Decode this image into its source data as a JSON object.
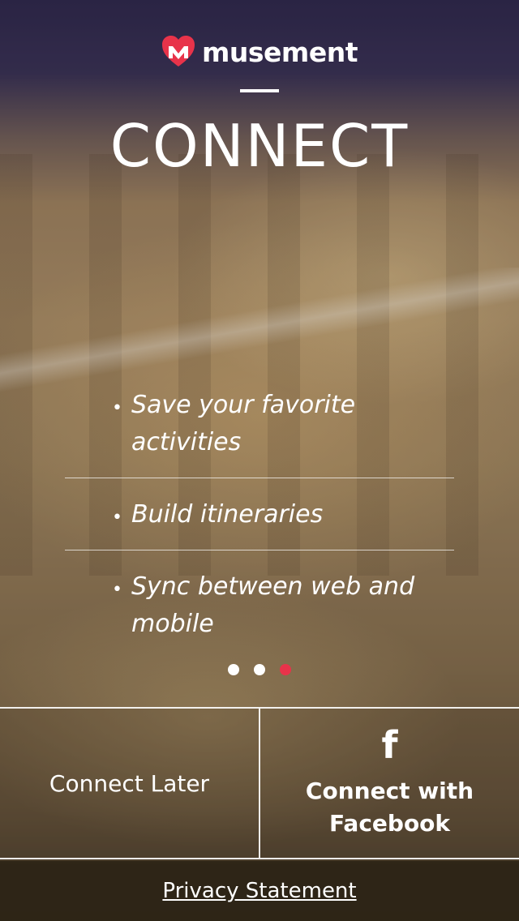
{
  "brand": {
    "name": "musement",
    "accent_color": "#e8334a",
    "logo_icon": "heart-m-icon"
  },
  "header": {
    "title": "CONNECT"
  },
  "features": [
    {
      "text": "Save your favorite activities"
    },
    {
      "text": "Build itineraries"
    },
    {
      "text": "Sync between web and mobile"
    }
  ],
  "pager": {
    "count": 3,
    "active_index": 2
  },
  "actions": {
    "connect_later_label": "Connect Later",
    "facebook_icon": "facebook-f-icon",
    "facebook_label_line1": "Connect with",
    "facebook_label_line2": "Facebook"
  },
  "footer": {
    "privacy_label": "Privacy Statement"
  }
}
